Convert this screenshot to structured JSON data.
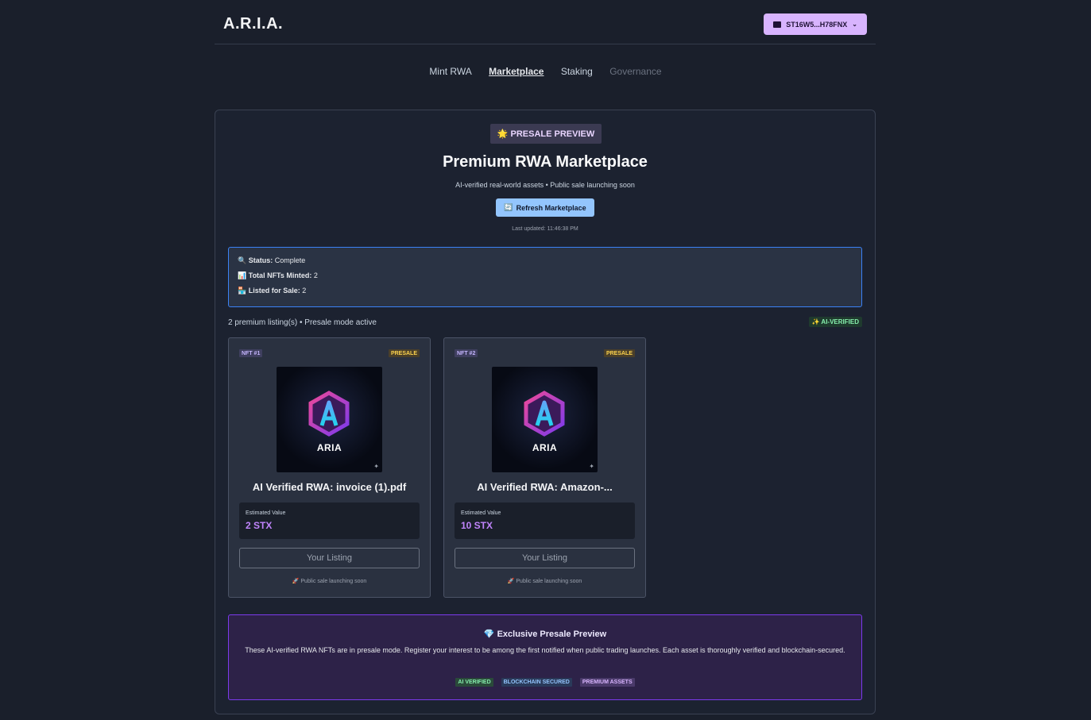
{
  "header": {
    "logo": "A.R.I.A.",
    "wallet_label": "ST16W5...H78FNX"
  },
  "nav": [
    {
      "label": "Mint RWA",
      "state": "normal"
    },
    {
      "label": "Marketplace",
      "state": "active"
    },
    {
      "label": "Staking",
      "state": "normal"
    },
    {
      "label": "Governance",
      "state": "disabled"
    }
  ],
  "marketplace": {
    "badge": "🌟 PRESALE PREVIEW",
    "title": "Premium RWA Marketplace",
    "subtitle": "AI-verified real-world assets • Public sale launching soon",
    "refresh_label": "Refresh Marketplace",
    "last_updated": "Last updated: 11:46:38 PM"
  },
  "status": {
    "status_label": "Status:",
    "status_value": "Complete",
    "minted_label": "Total NFTs Minted:",
    "minted_value": "2",
    "listed_label": "Listed for Sale:",
    "listed_value": "2"
  },
  "listings_summary": "2 premium listing(s) • Presale mode active",
  "ai_badge": "✨ AI-VERIFIED",
  "cards": [
    {
      "nft_tag": "NFT #1",
      "presale_tag": "PRESALE",
      "image_label": "ARIA",
      "title": "AI Verified RWA: invoice (1).pdf",
      "value_label": "Estimated Value",
      "value": "2 STX",
      "button": "Your Listing",
      "note": "🚀 Public sale launching soon"
    },
    {
      "nft_tag": "NFT #2",
      "presale_tag": "PRESALE",
      "image_label": "ARIA",
      "title": "AI Verified RWA: Amazon-...",
      "value_label": "Estimated Value",
      "value": "10 STX",
      "button": "Your Listing",
      "note": "🚀 Public sale launching soon"
    }
  ],
  "promo": {
    "title": "💎 Exclusive Presale Preview",
    "text": "These AI-verified RWA NFTs are in presale mode. Register your interest to be among the first notified when public trading launches. Each asset is thoroughly verified and blockchain-secured.",
    "tags": [
      "AI VERIFIED",
      "BLOCKCHAIN SECURED",
      "PREMIUM ASSETS"
    ]
  },
  "colors": {
    "background": "#1a1f2b",
    "accent_purple": "#c084fc",
    "accent_blue": "#93c5fd",
    "wallet_bg": "#d8b4fe"
  }
}
